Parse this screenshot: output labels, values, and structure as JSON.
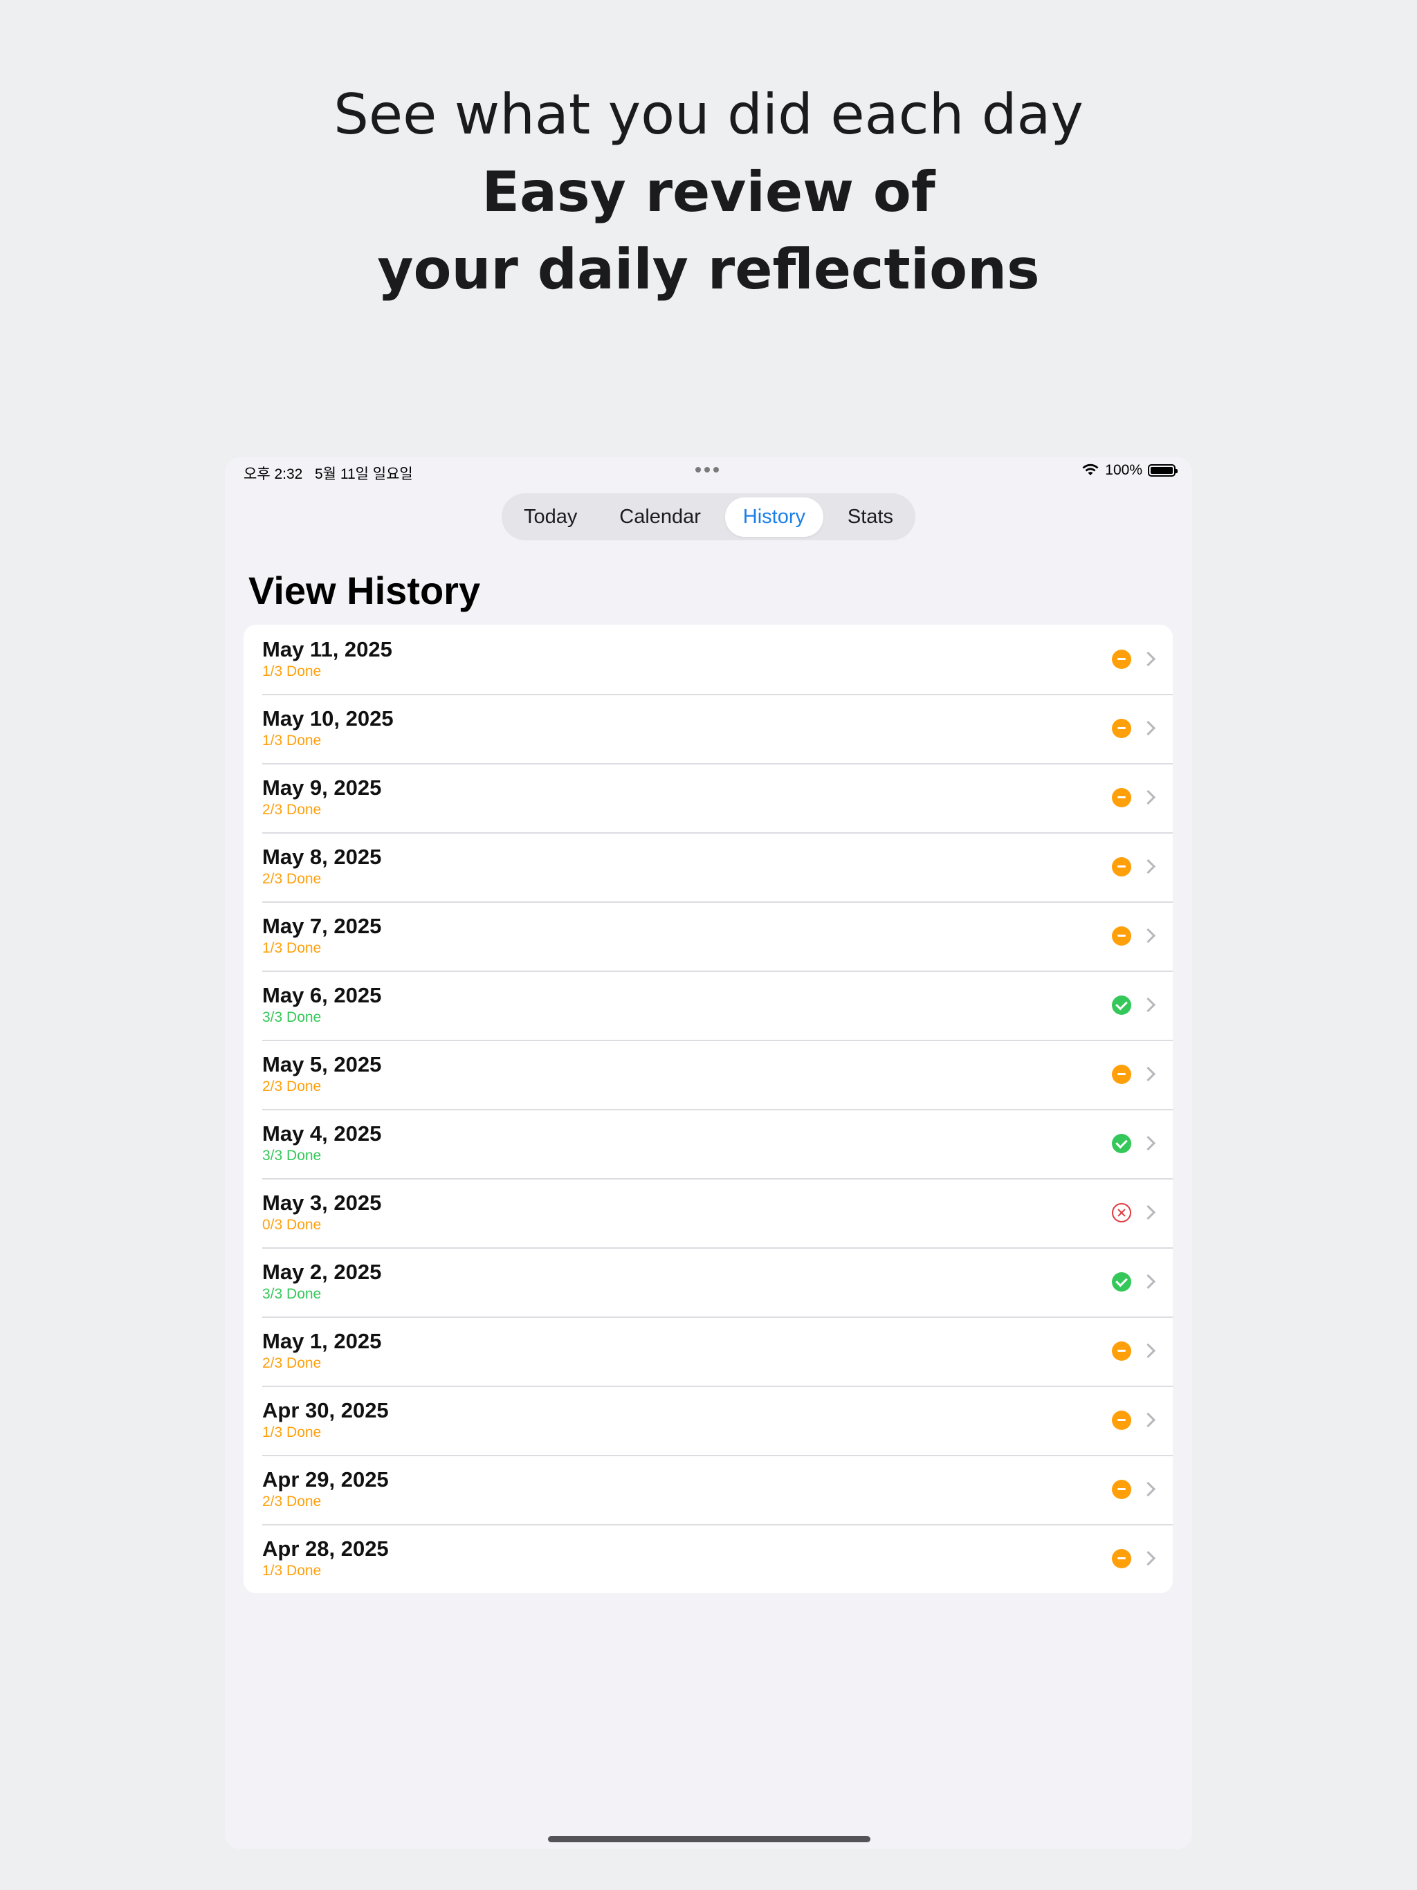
{
  "headline": {
    "line1": "See what you did each day",
    "line2": "Easy review of",
    "line3": "your daily reflections"
  },
  "statusbar": {
    "time": "오후 2:32",
    "date": "5월 11일 일요일",
    "battery": "100%"
  },
  "tabs": [
    {
      "label": "Today"
    },
    {
      "label": "Calendar"
    },
    {
      "label": "History",
      "active": true
    },
    {
      "label": "Stats"
    }
  ],
  "page_title": "View History",
  "colors": {
    "partial": "#ff9f0a",
    "done": "#34c759",
    "none": "#e0393e",
    "accent": "#1a7fe8"
  },
  "history": [
    {
      "date": "May 11, 2025",
      "status": "1/3 Done",
      "state": "partial",
      "icon": "minus-circle-icon"
    },
    {
      "date": "May 10, 2025",
      "status": "1/3 Done",
      "state": "partial",
      "icon": "minus-circle-icon"
    },
    {
      "date": "May 9, 2025",
      "status": "2/3 Done",
      "state": "partial",
      "icon": "minus-circle-icon"
    },
    {
      "date": "May 8, 2025",
      "status": "2/3 Done",
      "state": "partial",
      "icon": "minus-circle-icon"
    },
    {
      "date": "May 7, 2025",
      "status": "1/3 Done",
      "state": "partial",
      "icon": "minus-circle-icon"
    },
    {
      "date": "May 6, 2025",
      "status": "3/3 Done",
      "state": "done",
      "icon": "checkmark-circle-icon"
    },
    {
      "date": "May 5, 2025",
      "status": "2/3 Done",
      "state": "partial",
      "icon": "minus-circle-icon"
    },
    {
      "date": "May 4, 2025",
      "status": "3/3 Done",
      "state": "done",
      "icon": "checkmark-circle-icon"
    },
    {
      "date": "May 3, 2025",
      "status": "0/3 Done",
      "state": "none",
      "icon": "x-circle-icon"
    },
    {
      "date": "May 2, 2025",
      "status": "3/3 Done",
      "state": "done",
      "icon": "checkmark-circle-icon"
    },
    {
      "date": "May 1, 2025",
      "status": "2/3 Done",
      "state": "partial",
      "icon": "minus-circle-icon"
    },
    {
      "date": "Apr 30, 2025",
      "status": "1/3 Done",
      "state": "partial",
      "icon": "minus-circle-icon"
    },
    {
      "date": "Apr 29, 2025",
      "status": "2/3 Done",
      "state": "partial",
      "icon": "minus-circle-icon"
    },
    {
      "date": "Apr 28, 2025",
      "status": "1/3 Done",
      "state": "partial",
      "icon": "minus-circle-icon"
    }
  ]
}
